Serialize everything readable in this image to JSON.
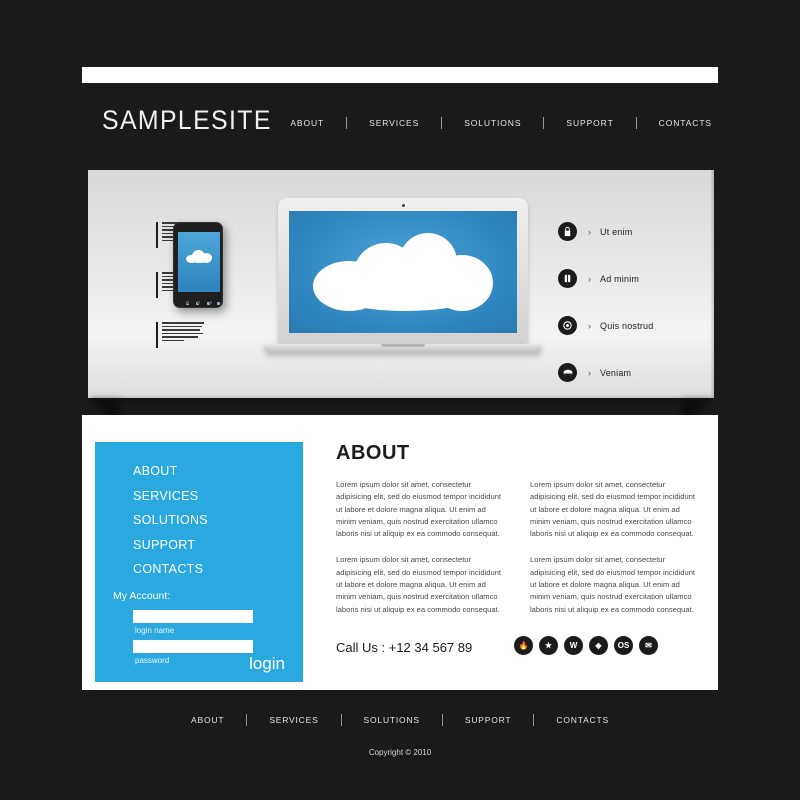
{
  "site": {
    "logo": "SAMPLESITE",
    "copyright": "Copyright © 2010"
  },
  "colors": {
    "background": "#1a1a1a",
    "accent_blue": "#29a9e0",
    "screen_blue": "#3390c8",
    "content_bg": "#ffffff",
    "icon_dark": "#1b1b1b"
  },
  "top_nav": [
    {
      "label": "ABOUT"
    },
    {
      "label": "SERVICES"
    },
    {
      "label": "SOLUTIONS"
    },
    {
      "label": "SUPPORT"
    },
    {
      "label": "CONTACTS"
    }
  ],
  "banner": {
    "micro_blocks": [
      {
        "text": "Lorem ipsum dolor sit amet, consectetur adipisicing elit, sed do eiusmod tempor incididunt ut labore et dolore magna aliqua."
      },
      {
        "text": "Lorem ipsum dolor sit amet, consectetur adipisicing elit, sed do eiusmod tempor incididunt ut labore et dolore magna aliqua."
      },
      {
        "text": "Lorem ipsum dolor sit amet, consectetur adipisicing elit, sed do eiusmod tempor incididunt ut labore et dolore magna aliqua."
      }
    ],
    "features": [
      {
        "icon": "lock-icon",
        "chevron": "›",
        "label": "Ut enim"
      },
      {
        "icon": "book-icon",
        "chevron": "›",
        "label": "Ad minim"
      },
      {
        "icon": "clock-icon",
        "chevron": "›",
        "label": "Quis nostrud"
      },
      {
        "icon": "cloud-icon",
        "chevron": "›",
        "label": "Veniam"
      }
    ]
  },
  "sidebar": {
    "menu": [
      {
        "label": "ABOUT"
      },
      {
        "label": "SERVICES"
      },
      {
        "label": "SOLUTIONS"
      },
      {
        "label": "SUPPORT"
      },
      {
        "label": "CONTACTS"
      }
    ],
    "account_label": "My Account:",
    "login_name": {
      "value": "",
      "placeholder": "",
      "caption": "login name"
    },
    "password": {
      "value": "",
      "placeholder": "",
      "caption": "password"
    },
    "login_button": "login"
  },
  "main": {
    "title": "ABOUT",
    "paragraph": "Lorem ipsum dolor sit amet, consectetur adipisicing elit, sed do eiusmod tempor incididunt ut labore et dolore magna aliqua. Ut enim ad minim veniam, quis nostrud exercitation ullamco laboris nisi ut aliquip ex ea commodo consequat.",
    "columns": [
      {
        "paragraphs": [
          "Lorem ipsum dolor sit amet, consectetur adipisicing elit, sed do eiusmod tempor incididunt ut labore et dolore magna aliqua. Ut enim ad minim veniam, quis nostrud exercitation ullamco laboris nisi ut aliquip ex ea commodo consequat.",
          "Lorem ipsum dolor sit amet, consectetur adipisicing elit, sed do eiusmod tempor incididunt ut labore et dolore magna aliqua. Ut enim ad minim veniam, quis nostrud exercitation ullamco laboris nisi ut aliquip ex ea commodo consequat."
        ]
      },
      {
        "paragraphs": [
          "Lorem ipsum dolor sit amet, consectetur adipisicing elit, sed do eiusmod tempor incididunt ut labore et dolore magna aliqua. Ut enim ad minim veniam, quis nostrud exercitation ullamco laboris nisi ut aliquip ex ea commodo consequat.",
          "Lorem ipsum dolor sit amet, consectetur adipisicing elit, sed do eiusmod tempor incididunt ut labore et dolore magna aliqua. Ut enim ad minim veniam, quis nostrud exercitation ullamco laboris nisi ut aliquip ex ea commodo consequat."
        ]
      }
    ],
    "call_us": "Call Us : +12 34 567 89",
    "socials": [
      {
        "icon": "flame-icon",
        "glyph": "🔥"
      },
      {
        "icon": "star-icon",
        "glyph": "★"
      },
      {
        "icon": "wordpress-icon",
        "glyph": "W"
      },
      {
        "icon": "compass-icon",
        "glyph": "◈"
      },
      {
        "icon": "os-icon",
        "glyph": "OS"
      },
      {
        "icon": "mail-icon",
        "glyph": "✉"
      }
    ]
  },
  "footer_nav": [
    {
      "label": "ABOUT"
    },
    {
      "label": "SERVICES"
    },
    {
      "label": "SOLUTIONS"
    },
    {
      "label": "SUPPORT"
    },
    {
      "label": "CONTACTS"
    }
  ]
}
